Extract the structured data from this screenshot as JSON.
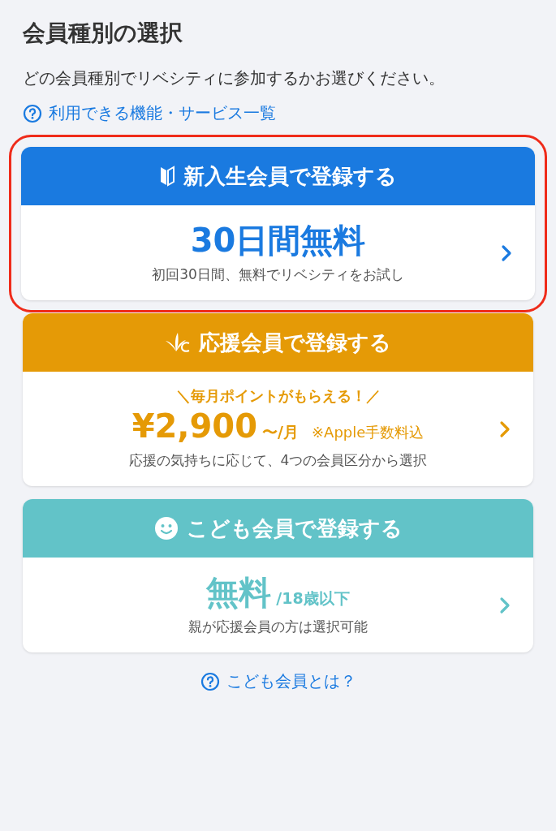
{
  "title": "会員種別の選択",
  "description": "どの会員種別でリベシティに参加するかお選びください。",
  "features_link": "利用できる機能・サービス一覧",
  "cards": [
    {
      "kind": "beginner",
      "color": "#1a7ae0",
      "highlighted": true,
      "title": "新入生会員で登録する",
      "price": "30日間無料",
      "description": "初回30日間、無料でリベシティをお試し"
    },
    {
      "kind": "supporter",
      "color": "#e59a06",
      "highlighted": false,
      "title": "応援会員で登録する",
      "tagline": "＼毎月ポイントがもらえる！／",
      "price": "¥2,900",
      "unit": "〜/月",
      "note": "※Apple手数料込",
      "description": "応援の気持ちに応じて、4つの会員区分から選択"
    },
    {
      "kind": "kids",
      "color": "#62c3c8",
      "highlighted": false,
      "title": "こども会員で登録する",
      "price": "無料",
      "unit": "/18歳以下",
      "description": "親が応援会員の方は選択可能"
    }
  ],
  "kids_link": "こども会員とは？"
}
